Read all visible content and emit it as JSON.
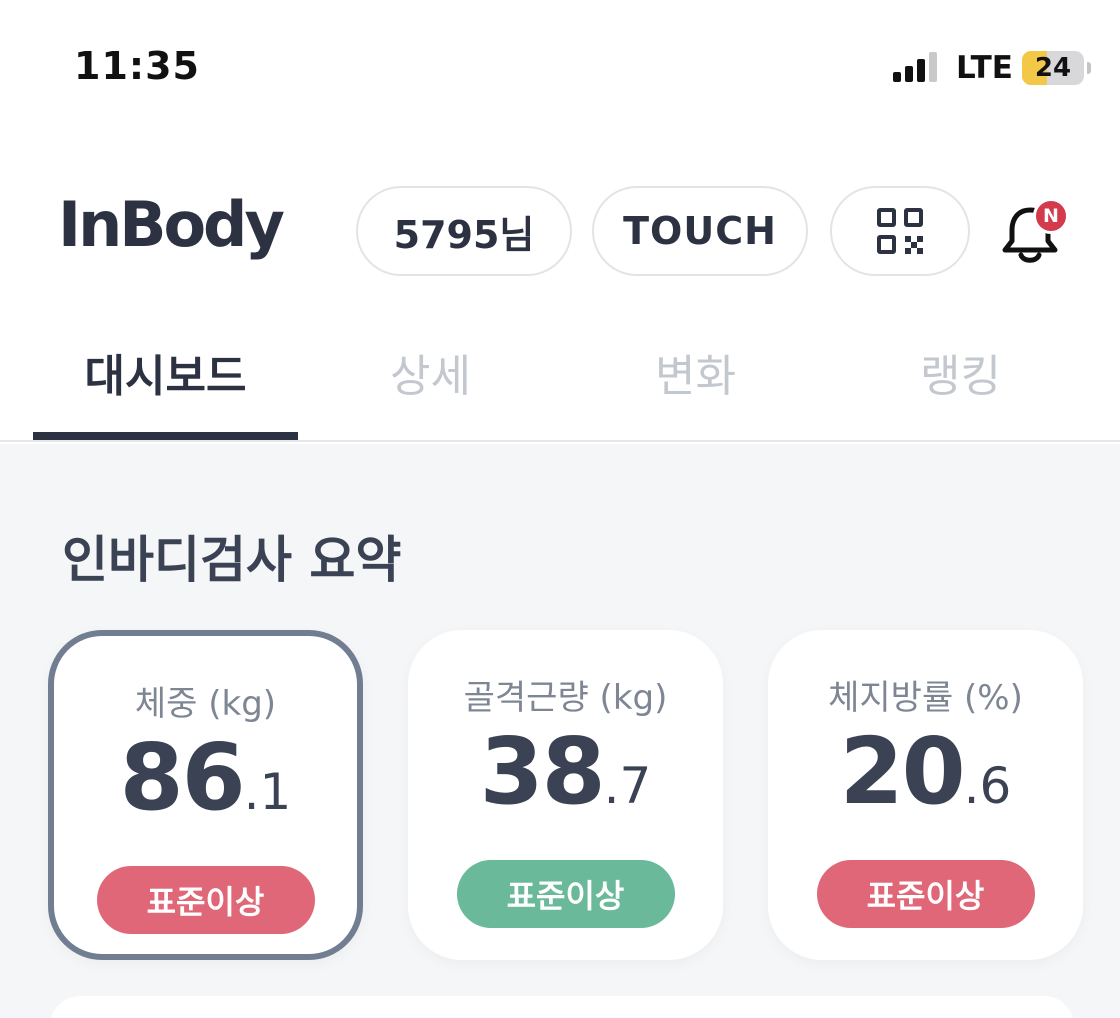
{
  "status_bar": {
    "time": "11:35",
    "network": "LTE",
    "battery_level": "24",
    "battery_color": "#f3c846"
  },
  "header": {
    "logo": "InBody",
    "user_button": "5795님",
    "touch_button": "TOUCH",
    "qr_icon": "qr-code-icon",
    "bell_icon": "bell-icon",
    "notification_badge": "N"
  },
  "tabs": [
    {
      "label": "대시보드",
      "active": true
    },
    {
      "label": "상세",
      "active": false
    },
    {
      "label": "변화",
      "active": false
    },
    {
      "label": "랭킹",
      "active": false
    }
  ],
  "summary": {
    "title": "인바디검사 요약",
    "metrics": [
      {
        "label": "체중 (kg)",
        "value_int": "86",
        "value_dec": ".1",
        "status": "표준이상",
        "status_color": "#e06778",
        "selected": true
      },
      {
        "label": "골격근량 (kg)",
        "value_int": "38",
        "value_dec": ".7",
        "status": "표준이상",
        "status_color": "#69b99a",
        "selected": false
      },
      {
        "label": "체지방률 (%)",
        "value_int": "20",
        "value_dec": ".6",
        "status": "표준이상",
        "status_color": "#e06778",
        "selected": false
      }
    ]
  },
  "colors": {
    "text_primary": "#3a4254",
    "tab_inactive": "#c3c7ce",
    "selected_border": "#717d91",
    "alert_red": "#d33a4b"
  }
}
